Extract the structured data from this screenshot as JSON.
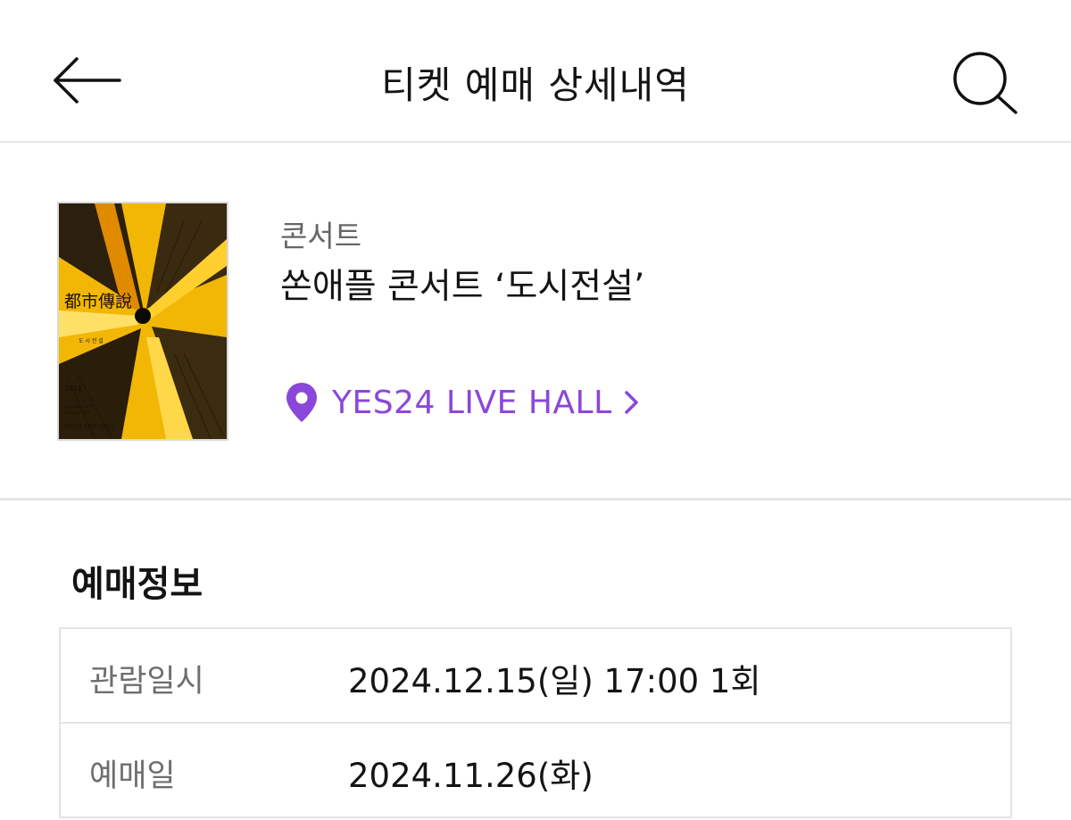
{
  "header": {
    "title": "티켓 예매 상세내역",
    "back_icon": "arrow-left-icon",
    "search_icon": "search-icon"
  },
  "event": {
    "category": "콘서트",
    "title": "쏜애플 콘서트 ‘도시전설’",
    "venue": "YES24 LIVE HALL",
    "venue_icon": "location-pin-icon",
    "venue_chevron_icon": "chevron-right-icon",
    "accent_color": "#8b47d9",
    "poster": {
      "title_hanja": "都市傳說",
      "subtitle": "도 시 전 설",
      "year": "2024",
      "dates": "12. 14. - 12. 15.",
      "times": [
        "Saturday 6PM",
        "Sunday 5PM"
      ],
      "venue": "YES24 LIVE HALL"
    }
  },
  "booking": {
    "heading": "예매정보",
    "rows": [
      {
        "label": "관람일시",
        "value": "2024.12.15(일) 17:00 1회"
      },
      {
        "label": "예매일",
        "value": "2024.11.26(화)"
      }
    ]
  }
}
